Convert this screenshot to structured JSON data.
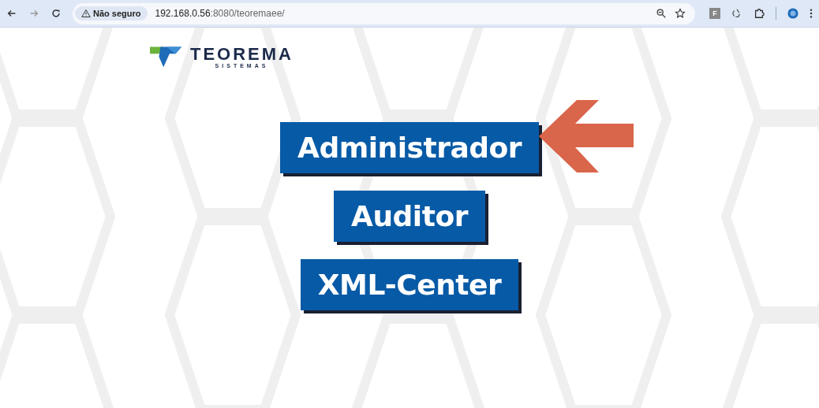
{
  "browser": {
    "security_label": "Não seguro",
    "url_host": "192.168.0.56",
    "url_rest": ":8080/teoremaee/",
    "extension_letter": "F"
  },
  "logo": {
    "name": "TEOREMA",
    "subtitle": "SISTEMAS"
  },
  "buttons": [
    {
      "label": "Administrador",
      "pointed": true
    },
    {
      "label": "Auditor",
      "pointed": false
    },
    {
      "label": "XML-Center",
      "pointed": false
    }
  ]
}
